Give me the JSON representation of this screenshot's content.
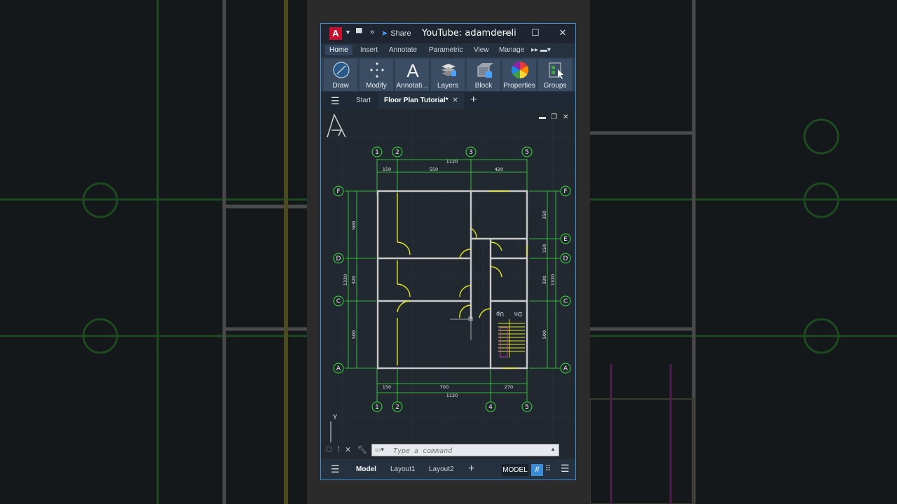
{
  "window": {
    "app_icon": "A",
    "share_label": "Share",
    "title": "YouTube: adamdereli",
    "minimize": "—",
    "maximize": "☐",
    "close": "✕"
  },
  "menu": {
    "items": [
      "Home",
      "Insert",
      "Annotate",
      "Parametric",
      "View",
      "Manage"
    ]
  },
  "ribbon": {
    "buttons": [
      "Draw",
      "Modify",
      "Annotati...",
      "Layers",
      "Block",
      "Properties",
      "Groups"
    ]
  },
  "tabs": {
    "start": "Start",
    "active": "Floor Plan Tutorial*",
    "close": "✕",
    "new": "+"
  },
  "drawing": {
    "grid_top": [
      "1",
      "2",
      "3",
      "5"
    ],
    "grid_bottom": [
      "1",
      "2",
      "4",
      "5"
    ],
    "grid_left": [
      "F",
      "D",
      "C",
      "A"
    ],
    "grid_right": [
      "F",
      "E",
      "D",
      "C",
      "A"
    ],
    "dim_top_total": "1120",
    "dim_top_segments": [
      "150",
      "550",
      "420"
    ],
    "dim_bottom_segments": [
      "150",
      "700",
      "270"
    ],
    "dim_bottom_total": "1120",
    "dim_left_total": "1320",
    "dim_left_segments": [
      "500",
      "320",
      "500"
    ],
    "dim_right_total": "1320",
    "dim_right_segments": [
      "350",
      "150",
      "320",
      "500"
    ],
    "stair_up": "Up",
    "stair_down": "Dn",
    "ucs_y": "Y"
  },
  "command": {
    "placeholder": "Type a command"
  },
  "status": {
    "model_tab": "Model",
    "layout1": "Layout1",
    "layout2": "Layout2",
    "add": "+",
    "space": "MODEL"
  },
  "colors": {
    "accent": "#3b8ed6",
    "grid_bubble": "#39e43a",
    "wall": "#c8c8c8",
    "door": "#e2e62a",
    "stair_magenta": "#b53aa8",
    "canvas": "#212830"
  }
}
